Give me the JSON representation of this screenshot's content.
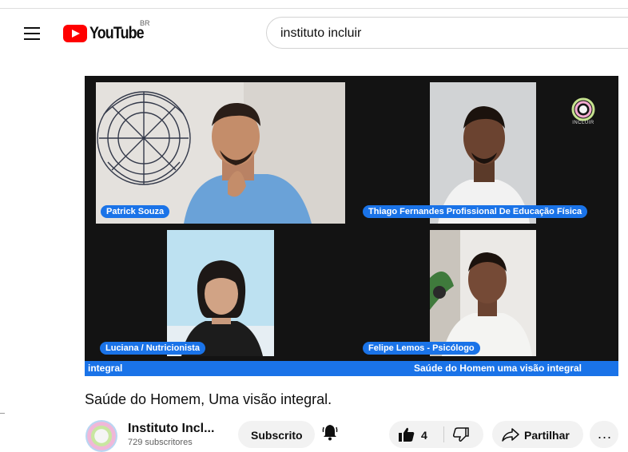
{
  "header": {
    "brand": "YouTube",
    "country": "BR",
    "search_value": "instituto incluir"
  },
  "video": {
    "participants": [
      "Patrick Souza",
      "Thiago Fernandes Profissional De Educação Física",
      "Luciana / Nutricionista",
      "Felipe Lemos - Psicólogo"
    ],
    "banner_left": "integral",
    "banner_right": "Saúde do Homem uma visão integral",
    "brand_mark": "INCLUIR"
  },
  "title": "Saúde do Homem, Uma visão integral.",
  "channel": {
    "name": "Instituto Incl...",
    "subscribers": "729 subscritores"
  },
  "actions": {
    "subscribe_label": "Subscrito",
    "like_count": "4",
    "share_label": "Partilhar",
    "more_label": "..."
  },
  "icons": [
    "menu-icon",
    "youtube-logo-icon",
    "bell-icon",
    "like-icon",
    "dislike-icon",
    "share-icon",
    "more-icon"
  ],
  "colors": {
    "brand_red": "#ff0000",
    "name_tag_blue": "#1a73e8",
    "video_background": "#131313"
  }
}
